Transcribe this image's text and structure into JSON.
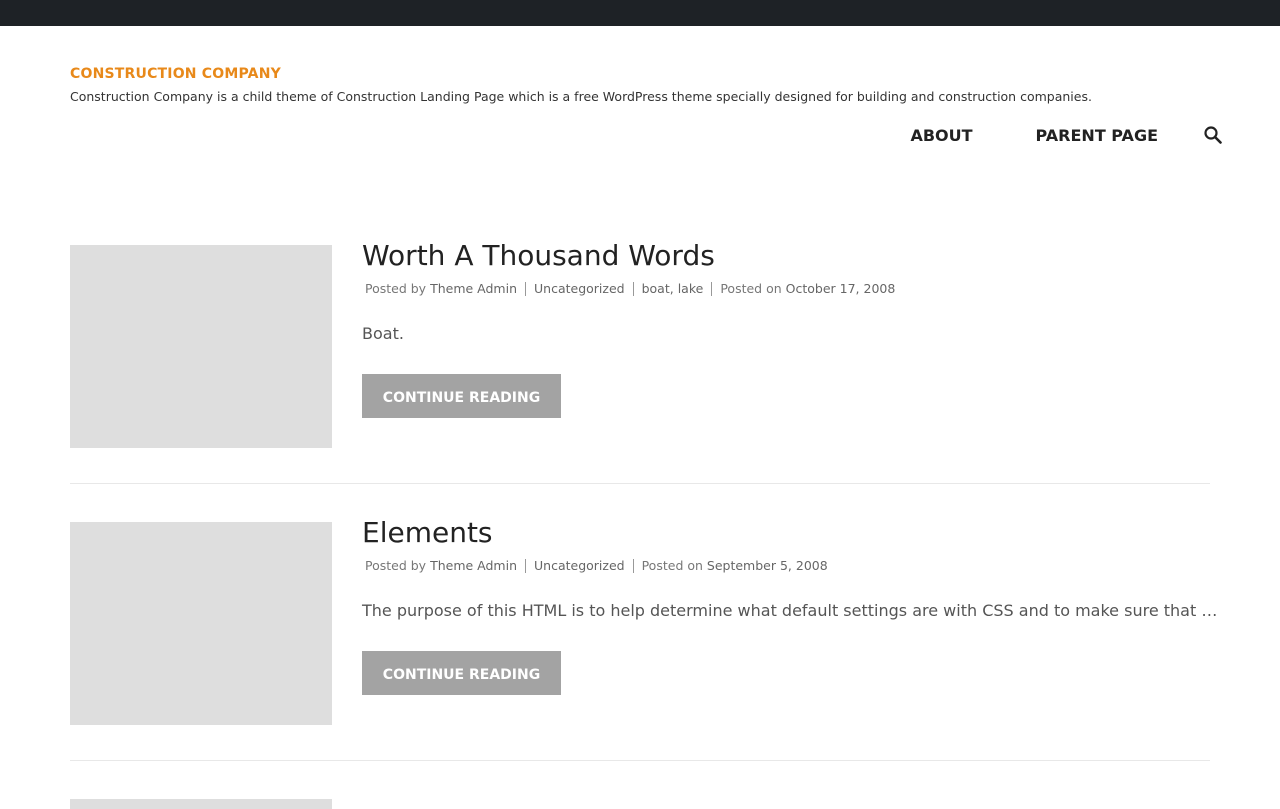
{
  "site": {
    "title": "CONSTRUCTION COMPANY",
    "description": "Construction Company is a child theme of Construction Landing Page which is a free WordPress theme specially designed for building and construction companies.",
    "accent_color": "#e8891a"
  },
  "nav": {
    "items": [
      {
        "label": "ABOUT"
      },
      {
        "label": "PARENT PAGE"
      }
    ],
    "search_icon": "search-icon"
  },
  "posts": [
    {
      "title": "Worth A Thousand Words",
      "meta": {
        "posted_by_label": "Posted by",
        "author": "Theme Admin",
        "category": "Uncategorized",
        "tags": [
          "boat",
          "lake"
        ],
        "posted_on_label": "Posted on",
        "date": "October 17, 2008"
      },
      "excerpt": "Boat.",
      "button": "CONTINUE READING"
    },
    {
      "title": "Elements",
      "meta": {
        "posted_by_label": "Posted by",
        "author": "Theme Admin",
        "category": "Uncategorized",
        "posted_on_label": "Posted on",
        "date": "September 5, 2008"
      },
      "excerpt": "The purpose of this HTML is to help determine what default settings are with CSS and to make sure that …",
      "button": "CONTINUE READING"
    }
  ],
  "colors": {
    "topbar": "#1e2226",
    "button_bg": "#a3a3a3",
    "thumb_placeholder": "#dedede"
  }
}
